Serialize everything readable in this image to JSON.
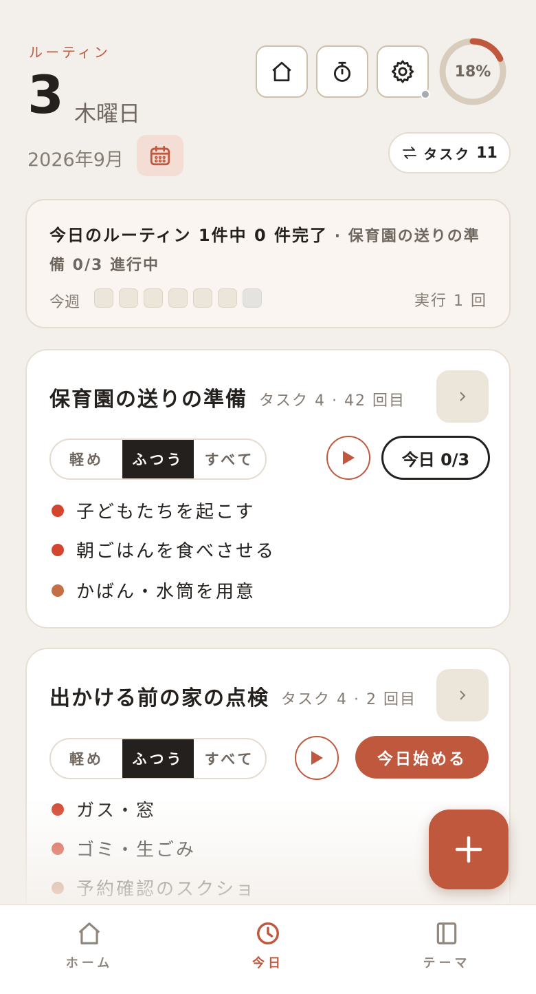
{
  "header": {
    "app_label": "ルーティン",
    "day": "3",
    "weekday": "木曜日",
    "month": "2026年9月",
    "progress_percent": 18,
    "progress_label": "18%",
    "task_pill_label": "タスク",
    "task_pill_count": "11",
    "icons": [
      "home-icon",
      "timer-icon",
      "gear-icon",
      "calendar-icon",
      "swap-icon"
    ]
  },
  "summary": {
    "headline": "今日のルーティン 1件中 0 件完了",
    "detail": "· 保育園の送りの準備 0/3 進行中",
    "week_label": "今週",
    "week_days": 7,
    "run_count": "実行 1 回"
  },
  "routines": [
    {
      "title": "保育園の送りの準備",
      "meta": "タスク 4 · 42 回目",
      "modes": [
        "軽め",
        "ふつう",
        "すべて"
      ],
      "selected_mode": "ふつう",
      "status_label": "今日 0/3",
      "tasks": [
        {
          "label": "子どもたちを起こす",
          "color": "#d4452f"
        },
        {
          "label": "朝ごはんを食べさせる",
          "color": "#d4452f"
        },
        {
          "label": "かばん・水筒を用意",
          "color": "#c56e45"
        }
      ]
    },
    {
      "title": "出かける前の家の点検",
      "meta": "タスク 4 · 2 回目",
      "modes": [
        "軽め",
        "ふつう",
        "すべて"
      ],
      "selected_mode": "ふつう",
      "action_label": "今日始める",
      "tasks": [
        {
          "label": "ガス・窓",
          "color": "#d4452f"
        },
        {
          "label": "ゴミ・生ごみ",
          "color": "#d4452f"
        },
        {
          "label": "予約確認のスクショ",
          "color": "#c56e45"
        }
      ]
    }
  ],
  "nav": {
    "items": [
      {
        "label": "ホーム",
        "icon": "home-icon"
      },
      {
        "label": "今日",
        "icon": "clock-icon"
      },
      {
        "label": "テーマ",
        "icon": "book-icon"
      }
    ],
    "active": "今日"
  },
  "colors": {
    "accent": "#c0583e",
    "background": "#f3efea",
    "dark": "#23201d"
  }
}
